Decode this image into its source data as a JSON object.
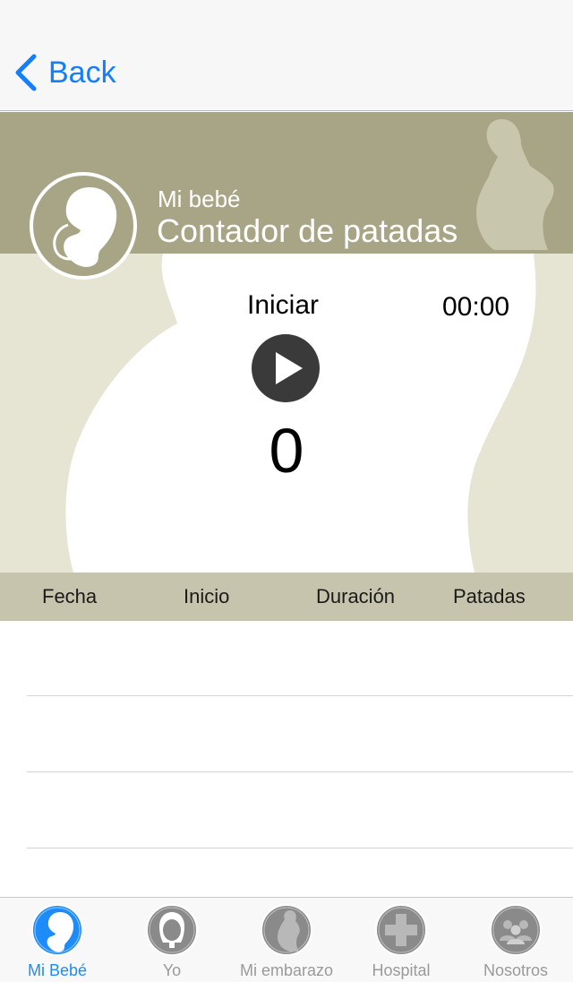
{
  "nav": {
    "back_label": "Back"
  },
  "header": {
    "subtitle": "Mi bebé",
    "title": "Contador de patadas"
  },
  "counter": {
    "start_label": "Iniciar",
    "timer": "00:00",
    "count": "0"
  },
  "table": {
    "columns": [
      "Fecha",
      "Inicio",
      "Duración",
      "Patadas"
    ],
    "rows": []
  },
  "tabbar": {
    "active": 0,
    "items": [
      {
        "label": "Mi Bebé",
        "icon": "fetus-icon"
      },
      {
        "label": "Yo",
        "icon": "woman-face-icon"
      },
      {
        "label": "Mi embarazo",
        "icon": "pregnant-icon"
      },
      {
        "label": "Hospital",
        "icon": "cross-icon"
      },
      {
        "label": "Nosotros",
        "icon": "group-icon"
      }
    ]
  },
  "colors": {
    "accent": "#147efb",
    "band": "#a8a586",
    "background": "#e6e4d2",
    "table_header": "#c7c4ad"
  }
}
